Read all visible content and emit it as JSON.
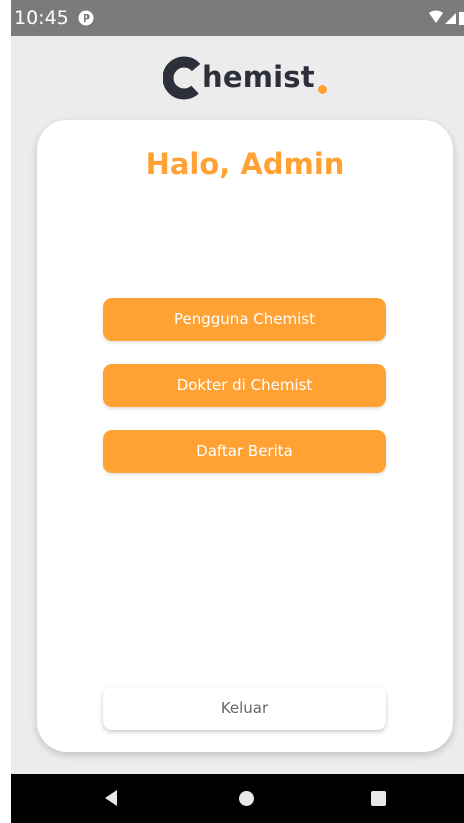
{
  "status_bar": {
    "time": "10:45"
  },
  "logo": {
    "brand_text": "hemist",
    "brand_full": "Chemist.",
    "icon": "chemist-c-logo",
    "accent_color": "#ffa233",
    "dark_color": "#2d2f3b"
  },
  "card": {
    "greeting": "Halo, Admin",
    "menu": [
      {
        "label": "Pengguna Chemist"
      },
      {
        "label": "Dokter di Chemist"
      },
      {
        "label": "Daftar Berita"
      }
    ],
    "logout_label": "Keluar"
  },
  "nav_bar": {
    "icons": [
      "back-icon",
      "home-icon",
      "recents-icon"
    ]
  },
  "colors": {
    "accent": "#ffa233",
    "background": "#ececec",
    "card": "#ffffff",
    "status_bar": "#7b7b7b"
  }
}
